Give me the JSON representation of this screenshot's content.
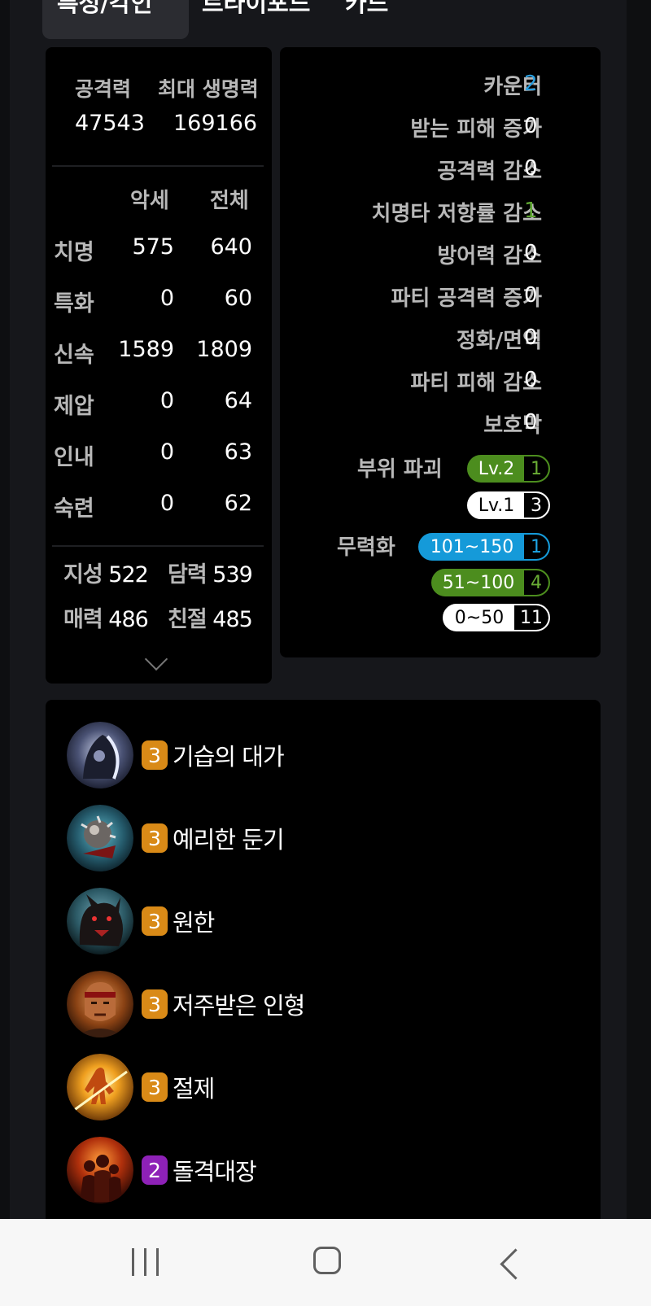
{
  "tabs": [
    {
      "label": "특성/각인"
    },
    {
      "label": "트라이포드"
    },
    {
      "label": "카드"
    }
  ],
  "stats": {
    "attack_label": "공격력",
    "attack_value": "47543",
    "hp_label": "최대 생명력",
    "hp_value": "169166",
    "col_accessory": "악세",
    "col_total": "전체",
    "rows": [
      {
        "label": "치명",
        "acc": "575",
        "total": "640"
      },
      {
        "label": "특화",
        "acc": "0",
        "total": "60"
      },
      {
        "label": "신속",
        "acc": "1589",
        "total": "1809"
      },
      {
        "label": "제압",
        "acc": "0",
        "total": "64"
      },
      {
        "label": "인내",
        "acc": "0",
        "total": "63"
      },
      {
        "label": "숙련",
        "acc": "0",
        "total": "62"
      }
    ],
    "attrs": [
      {
        "label": "지성",
        "value": "522"
      },
      {
        "label": "담력",
        "value": "539"
      },
      {
        "label": "매력",
        "value": "486"
      },
      {
        "label": "친절",
        "value": "485"
      }
    ]
  },
  "effects": {
    "rows": [
      {
        "label": "카운터",
        "value": "2",
        "color": "#2a9fe0"
      },
      {
        "label": "받는 피해 증가",
        "value": "0",
        "color": "#ffffff"
      },
      {
        "label": "공격력 감소",
        "value": "0",
        "color": "#ffffff"
      },
      {
        "label": "치명타 저항률 감소",
        "value": "1",
        "color": "#5fa832"
      },
      {
        "label": "방어력 감소",
        "value": "0",
        "color": "#ffffff"
      },
      {
        "label": "파티 공격력 증가",
        "value": "0",
        "color": "#ffffff"
      },
      {
        "label": "정화/면역",
        "value": "0",
        "color": "#ffffff"
      },
      {
        "label": "파티 피해 감소",
        "value": "0",
        "color": "#ffffff"
      },
      {
        "label": "보호막",
        "value": "0",
        "color": "#ffffff"
      }
    ],
    "part_break_label": "부위 파괴",
    "part_break": [
      {
        "level": "Lv.2",
        "count": "1"
      },
      {
        "level": "Lv.1",
        "count": "3"
      }
    ],
    "stagger_label": "무력화",
    "stagger": [
      {
        "range": "101~150",
        "count": "1"
      },
      {
        "range": "51~100",
        "count": "4"
      },
      {
        "range": "0~50",
        "count": "11"
      }
    ]
  },
  "engravings": [
    {
      "level": "3",
      "name": "기습의 대가",
      "icon": "hooded-assassin-icon"
    },
    {
      "level": "3",
      "name": "예리한 둔기",
      "icon": "spiked-mace-icon"
    },
    {
      "level": "3",
      "name": "원한",
      "icon": "demon-beast-icon"
    },
    {
      "level": "3",
      "name": "저주받은 인형",
      "icon": "cursed-doll-icon"
    },
    {
      "level": "3",
      "name": "절제",
      "icon": "flame-warrior-icon"
    },
    {
      "level": "2",
      "name": "돌격대장",
      "icon": "charging-crowd-icon"
    }
  ],
  "colors": {
    "orange_badge": "#d98a17",
    "purple_badge": "#8e21b7",
    "green": "#4c8d1e",
    "blue": "#159ad9"
  }
}
